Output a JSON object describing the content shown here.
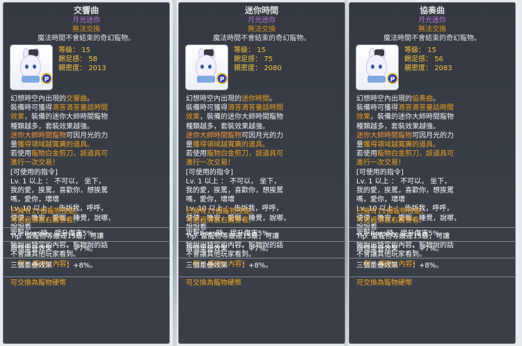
{
  "tooltips": [
    {
      "title": "交響曲",
      "rank": "月光迷你",
      "trade": "無法交換",
      "description": "魔法時間不會結束的奇幻寵物。",
      "stats": {
        "level_label": "等級",
        "level": "15",
        "fullness_label": "飽足感",
        "fullness": "58",
        "closeness_label": "親密度",
        "closeness": "2013"
      },
      "body": [
        {
          "parts": [
            {
              "t": "幻想時空內出現的",
              "c": "w"
            },
            {
              "t": "交響曲",
              "c": "y"
            },
            {
              "t": "。",
              "c": "w"
            }
          ]
        },
        {
          "parts": [
            {
              "t": "裝備時可獲得",
              "c": "w"
            },
            {
              "t": "滴答滴答童話時間",
              "c": "y"
            }
          ]
        },
        {
          "parts": [
            {
              "t": "效果",
              "c": "y"
            },
            {
              "t": "，裝備的迷你大師時間寵物",
              "c": "w"
            }
          ]
        },
        {
          "parts": [
            {
              "t": "種類越多，套裝效果越強。",
              "c": "w"
            }
          ]
        },
        {
          "parts": [
            {
              "t": "迷你大師時間寵物",
              "c": "o"
            },
            {
              "t": "可因月光的力",
              "c": "w"
            }
          ]
        },
        {
          "parts": [
            {
              "t": "量",
              "c": "w"
            },
            {
              "t": "獲得領域越寬廣的道具。",
              "c": "y"
            }
          ]
        },
        {
          "parts": [
            {
              "t": "若使用",
              "c": "w"
            },
            {
              "t": "寵物白金剪刀，該道具可",
              "c": "y"
            }
          ]
        },
        {
          "parts": [
            {
              "t": "進行一次交易！",
              "c": "y"
            }
          ]
        },
        {
          "parts": [
            {
              "t": "[可使用的指令]",
              "c": "w"
            }
          ]
        },
        {
          "parts": [
            {
              "t": "Lv. 1 以上 ： 不可以， 坐下，",
              "c": "w"
            }
          ]
        },
        {
          "parts": [
            {
              "t": "我的愛，挨罵，喜歡你，想挨罵",
              "c": "w"
            }
          ]
        },
        {
          "parts": [
            {
              "t": "嗎，愛你，壞壞",
              "c": "w"
            }
          ]
        },
        {
          "parts": [
            {
              "t": "Lv. 10 以上 ： 告訴我，呼呼，",
              "c": "w"
            }
          ]
        },
        {
          "parts": [
            {
              "t": "便便，晚安，愛睏，睡覺，說哪，",
              "c": "w"
            }
          ]
        },
        {
          "parts": [
            {
              "t": "說說看",
              "c": "w"
            }
          ]
        },
        {
          "parts": [
            {
              "t": "Tip. 當寵物等級達15級，可讓",
              "c": "w"
            }
          ]
        },
        {
          "parts": [
            {
              "t": "牠說出特定的內容。寵物說的話",
              "c": "w"
            }
          ]
        },
        {
          "parts": [
            {
              "t": "不會讓其他玩家看到。",
              "c": "w"
            }
          ]
        }
      ],
      "example": "例）/寵物 [內容]",
      "skills": "已擁有11個寵物技能。",
      "skills_hint": "可透過滑鼠右鍵查看。",
      "boss": "攻擊Boss時，提升傷害5%。",
      "stack2_label": "兩個重疊效果",
      "stack2_value": "：+7%。",
      "stack3_label": "三個重疊效果",
      "stack3_value": "：+8%。",
      "hardness": "可交換為寵物硬幣"
    },
    {
      "title": "迷你時間",
      "rank": "月光迷你",
      "trade": "無法交換",
      "description": "魔法時間不會結束的奇幻寵物。",
      "stats": {
        "level_label": "等級",
        "level": "15",
        "fullness_label": "飽足感",
        "fullness": "75",
        "closeness_label": "親密度",
        "closeness": "2080"
      },
      "body": [
        {
          "parts": [
            {
              "t": "幻想時空內出現的",
              "c": "w"
            },
            {
              "t": "迷你時間",
              "c": "y"
            },
            {
              "t": "。",
              "c": "w"
            }
          ]
        },
        {
          "parts": [
            {
              "t": "裝備時可獲得",
              "c": "w"
            },
            {
              "t": "滴答滴答童話時間",
              "c": "y"
            }
          ]
        },
        {
          "parts": [
            {
              "t": "效果",
              "c": "y"
            },
            {
              "t": "，裝備的迷你大師時間寵物",
              "c": "w"
            }
          ]
        },
        {
          "parts": [
            {
              "t": "種類越多，套裝效果越強。",
              "c": "w"
            }
          ]
        },
        {
          "parts": [
            {
              "t": "迷你大師時間寵物",
              "c": "o"
            },
            {
              "t": "可因月光的力",
              "c": "w"
            }
          ]
        },
        {
          "parts": [
            {
              "t": "量",
              "c": "w"
            },
            {
              "t": "獲得領域越寬廣的道具。",
              "c": "y"
            }
          ]
        },
        {
          "parts": [
            {
              "t": "若使用",
              "c": "w"
            },
            {
              "t": "寵物白金剪刀，該道具可",
              "c": "y"
            }
          ]
        },
        {
          "parts": [
            {
              "t": "進行一次交易！",
              "c": "y"
            }
          ]
        },
        {
          "parts": [
            {
              "t": "[可使用的指令]",
              "c": "w"
            }
          ]
        },
        {
          "parts": [
            {
              "t": "Lv. 1 以上 ： 不可以， 坐下，",
              "c": "w"
            }
          ]
        },
        {
          "parts": [
            {
              "t": "我的愛，挨罵，喜歡你，想挨罵",
              "c": "w"
            }
          ]
        },
        {
          "parts": [
            {
              "t": "嗎，愛你，壞壞",
              "c": "w"
            }
          ]
        },
        {
          "parts": [
            {
              "t": "Lv. 10 以上 ： 告訴我，呼呼，",
              "c": "w"
            }
          ]
        },
        {
          "parts": [
            {
              "t": "便便，晚安，愛睏，睡覺，說哪，",
              "c": "w"
            }
          ]
        },
        {
          "parts": [
            {
              "t": "說說看",
              "c": "w"
            }
          ]
        },
        {
          "parts": [
            {
              "t": "Tip. 當寵物等級達15級，可讓",
              "c": "w"
            }
          ]
        },
        {
          "parts": [
            {
              "t": "牠說出特定的內容。寵物說的話",
              "c": "w"
            }
          ]
        },
        {
          "parts": [
            {
              "t": "不會讓其他玩家看到。",
              "c": "w"
            }
          ]
        }
      ],
      "example": "例）/寵物 [內容]",
      "skills": "已擁有11個寵物技能。",
      "skills_hint": "可透過滑鼠右鍵查看。",
      "boss": "攻擊Boss時，提升傷害5%。",
      "stack2_label": "兩個重疊效果",
      "stack2_value": "：+7%。",
      "stack3_label": "三個重疊效果",
      "stack3_value": "：+8%。",
      "hardness": "可交換為寵物硬幣"
    },
    {
      "title": "協奏曲",
      "rank": "月光迷你",
      "trade": "無法交換",
      "description": "魔法時間不會結束的奇幻寵物。",
      "stats": {
        "level_label": "等級",
        "level": "15",
        "fullness_label": "飽足感",
        "fullness": "56",
        "closeness_label": "親密度",
        "closeness": "2083"
      },
      "body": [
        {
          "parts": [
            {
              "t": "幻想時空內出現的",
              "c": "w"
            },
            {
              "t": "協奏曲",
              "c": "y"
            },
            {
              "t": "。",
              "c": "w"
            }
          ]
        },
        {
          "parts": [
            {
              "t": "裝備時可獲得",
              "c": "w"
            },
            {
              "t": "滴答滴答童話時間",
              "c": "y"
            }
          ]
        },
        {
          "parts": [
            {
              "t": "效果",
              "c": "y"
            },
            {
              "t": "，裝備的迷你大師時間寵物",
              "c": "w"
            }
          ]
        },
        {
          "parts": [
            {
              "t": "種類越多，套裝效果越強。",
              "c": "w"
            }
          ]
        },
        {
          "parts": [
            {
              "t": "迷你大師時間寵物",
              "c": "o"
            },
            {
              "t": "可因月光的力",
              "c": "w"
            }
          ]
        },
        {
          "parts": [
            {
              "t": "量",
              "c": "w"
            },
            {
              "t": "獲得領域越寬廣的道具。",
              "c": "y"
            }
          ]
        },
        {
          "parts": [
            {
              "t": "若使用",
              "c": "w"
            },
            {
              "t": "寵物白金剪刀，該道具可",
              "c": "y"
            }
          ]
        },
        {
          "parts": [
            {
              "t": "進行一次交易！",
              "c": "y"
            }
          ]
        },
        {
          "parts": [
            {
              "t": "[可使用的指令]",
              "c": "w"
            }
          ]
        },
        {
          "parts": [
            {
              "t": "Lv. 1 以上 ： 不可以， 坐下，",
              "c": "w"
            }
          ]
        },
        {
          "parts": [
            {
              "t": "我的愛，挨罵，喜歡你，想挨罵",
              "c": "w"
            }
          ]
        },
        {
          "parts": [
            {
              "t": "嗎，愛你，壞壞",
              "c": "w"
            }
          ]
        },
        {
          "parts": [
            {
              "t": "Lv. 10 以上 ： 告訴我，呼呼，",
              "c": "w"
            }
          ]
        },
        {
          "parts": [
            {
              "t": "便便，晚安，愛睏，睡覺，說哪，",
              "c": "w"
            }
          ]
        },
        {
          "parts": [
            {
              "t": "說說看",
              "c": "w"
            }
          ]
        },
        {
          "parts": [
            {
              "t": "Tip. 當寵物等級達15級，可讓",
              "c": "w"
            }
          ]
        },
        {
          "parts": [
            {
              "t": "牠說出特定的內容。寵物說的話",
              "c": "w"
            }
          ]
        },
        {
          "parts": [
            {
              "t": "不會讓其他玩家看到。",
              "c": "w"
            }
          ]
        }
      ],
      "example": "例）/寵物 [內容]",
      "skills": "已擁有11個寵物技能。",
      "skills_hint": "可透過滑鼠右鍵查看。",
      "boss": "攻擊Boss時，提升傷害5%。",
      "stack2_label": "兩個重疊效果",
      "stack2_value": "：+7%。",
      "stack3_label": "三個重疊效果",
      "stack3_value": "：+8%。",
      "hardness": "可交換為寵物硬幣"
    }
  ],
  "badge_letter": "P"
}
